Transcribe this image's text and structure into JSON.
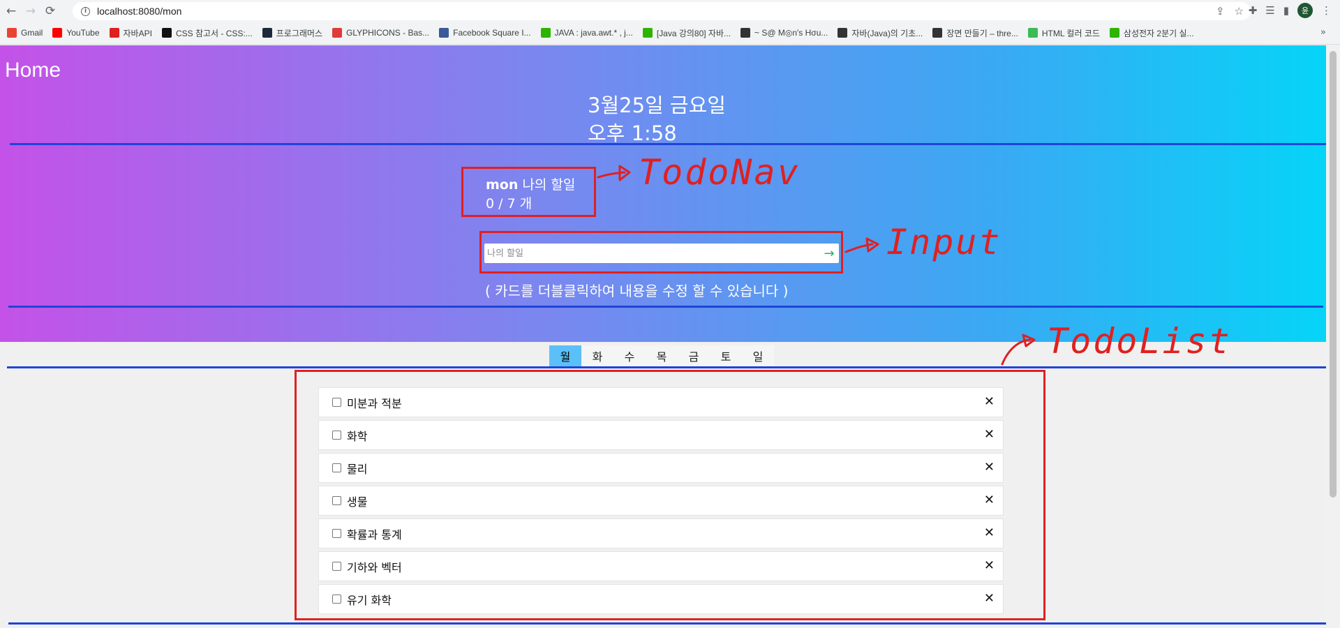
{
  "browser": {
    "url": "localhost:8080/mon",
    "bookmarks": [
      {
        "label": "Gmail",
        "color": "#ea4335"
      },
      {
        "label": "YouTube",
        "color": "#ff0000"
      },
      {
        "label": "자바API",
        "color": "#e02020"
      },
      {
        "label": "CSS 참고서 - CSS:...",
        "color": "#111111"
      },
      {
        "label": "프로그래머스",
        "color": "#1e2a3a"
      },
      {
        "label": "GLYPHICONS - Bas...",
        "color": "#e03a3a"
      },
      {
        "label": "Facebook Square I...",
        "color": "#3b5998"
      },
      {
        "label": "JAVA : java.awt.* , j...",
        "color": "#2db400"
      },
      {
        "label": "[Java 강의80] 자바...",
        "color": "#2db400"
      },
      {
        "label": "~ S@ M◎n's Hσu...",
        "color": "#333333"
      },
      {
        "label": "자바(Java)의 기초...",
        "color": "#333333"
      },
      {
        "label": "장면 만들기 – thre...",
        "color": "#333333"
      },
      {
        "label": "HTML 컬러 코드",
        "color": "#3cba54"
      },
      {
        "label": "삼성전자 2분기 실...",
        "color": "#2db400"
      }
    ],
    "more": "»",
    "profile_initial": "윤"
  },
  "header": {
    "title": "Home",
    "date_line1": "3월25일 금요일",
    "date_line2": "오후 1:58"
  },
  "todonav": {
    "day": "mon",
    "label": "나의 할일",
    "count": "0 / 7 개"
  },
  "input": {
    "placeholder": "나의 할일",
    "submit_icon": "→"
  },
  "hint": "( 카드를 더블클릭하여 내용을 수정 할 수 있습니다 )",
  "days": {
    "tabs": [
      "월",
      "화",
      "수",
      "목",
      "금",
      "토",
      "일"
    ],
    "active_index": 0
  },
  "todos": [
    {
      "text": "미분과 적분",
      "checked": false
    },
    {
      "text": "화학",
      "checked": false
    },
    {
      "text": "물리",
      "checked": false
    },
    {
      "text": "생물",
      "checked": false
    },
    {
      "text": "확률과 통계",
      "checked": false
    },
    {
      "text": "기하와 벡터",
      "checked": false
    },
    {
      "text": "유기 화학",
      "checked": false
    }
  ],
  "delete_symbol": "✕",
  "annotations": {
    "todonav_label": "TodoNav",
    "input_label": "Input",
    "todolist_label": "TodoList"
  }
}
